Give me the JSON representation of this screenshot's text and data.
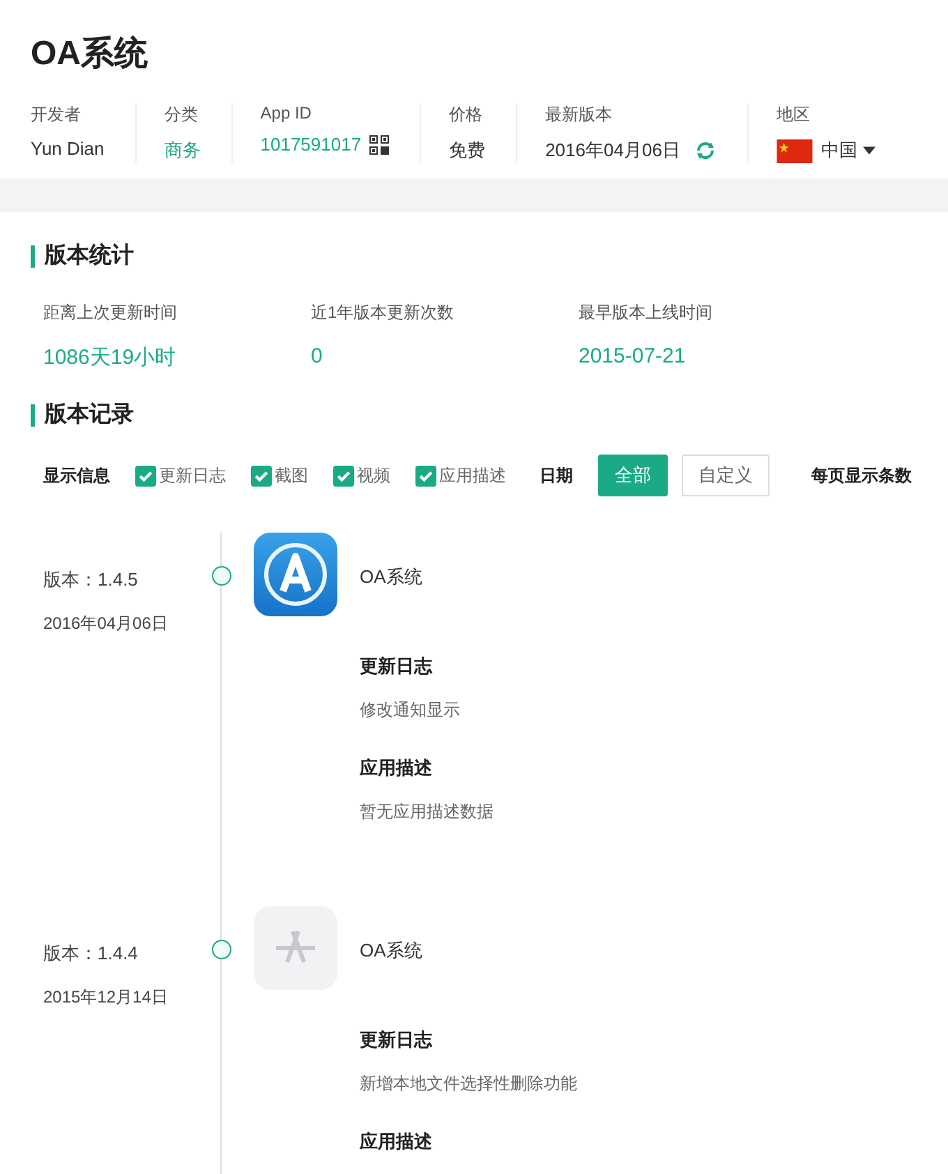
{
  "app": {
    "title": "OA系统"
  },
  "meta": [
    {
      "kind": "text",
      "label": "开发者",
      "value": "Yun Dian"
    },
    {
      "kind": "link",
      "label": "分类",
      "value": "商务"
    },
    {
      "kind": "appid",
      "label": "App ID",
      "value": "1017591017"
    },
    {
      "kind": "text",
      "label": "价格",
      "value": "免费"
    },
    {
      "kind": "version",
      "label": "最新版本",
      "value": "2016年04月06日"
    },
    {
      "kind": "region",
      "label": "地区",
      "value": "中国"
    }
  ],
  "stats": {
    "heading": "版本统计",
    "items": [
      {
        "label": "距离上次更新时间",
        "value": "1086天19小时"
      },
      {
        "label": "近1年版本更新次数",
        "value": "0"
      },
      {
        "label": "最早版本上线时间",
        "value": "2015-07-21"
      }
    ]
  },
  "records": {
    "heading": "版本记录",
    "filter_label": "显示信息",
    "filters": [
      {
        "label": "更新日志",
        "checked": true
      },
      {
        "label": "截图",
        "checked": true
      },
      {
        "label": "视频",
        "checked": true
      },
      {
        "label": "应用描述",
        "checked": true
      }
    ],
    "date_label": "日期",
    "date_options": [
      {
        "label": "全部",
        "selected": true
      },
      {
        "label": "自定义",
        "selected": false
      }
    ],
    "per_page_label": "每页显示条数",
    "entries": [
      {
        "version": "版本：1.4.5",
        "date": "2016年04月06日",
        "kind": "app",
        "name": "OA系统",
        "sections": [
          {
            "title": "更新日志",
            "text": "修改通知显示"
          },
          {
            "title": "应用描述",
            "text": "暂无应用描述数据"
          }
        ]
      },
      {
        "version": "版本：1.4.4",
        "date": "2015年12月14日",
        "kind": "generic",
        "name": "OA系统",
        "sections": [
          {
            "title": "更新日志",
            "text": "新增本地文件选择性删除功能"
          },
          {
            "title": "应用描述"
          }
        ]
      }
    ]
  }
}
